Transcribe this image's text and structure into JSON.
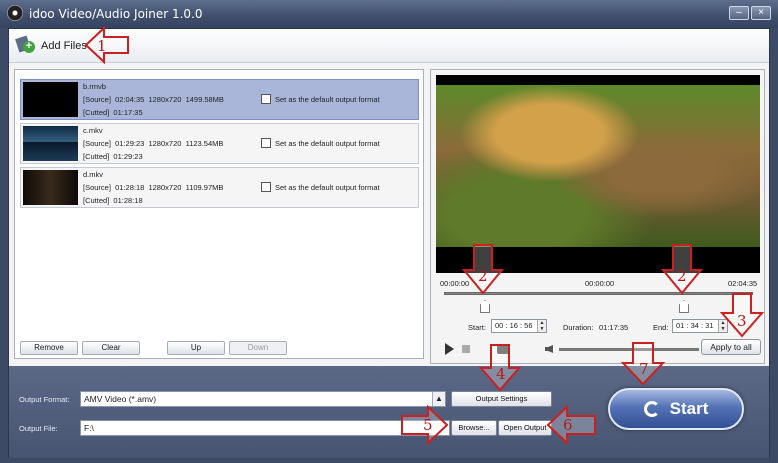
{
  "window": {
    "title": "idoo Video/Audio Joiner 1.0.0",
    "minimize": "–",
    "close": "×"
  },
  "toolbar": {
    "add_files_label": "Add Files"
  },
  "files": [
    {
      "name": "b.rmvb",
      "source": "[Source]  02:04:35  1280x720  1499.58MB",
      "cutted": "[Cutted]  01:17:35",
      "default_label": "Set as the default output format"
    },
    {
      "name": "c.mkv",
      "source": "[Source]  01:29:23  1280x720  1123.54MB",
      "cutted": "[Cutted]  01:29:23",
      "default_label": "Set as the default output format"
    },
    {
      "name": "d.mkv",
      "source": "[Source]  01:28:18  1280x720  1109.97MB",
      "cutted": "[Cutted]  01:28:18",
      "default_label": "Set as the default output format"
    }
  ],
  "list_buttons": {
    "remove": "Remove",
    "clear": "Clear",
    "up": "Up",
    "down": "Down"
  },
  "preview": {
    "time_start": "00:00:00",
    "time_mid": "00:00:00",
    "time_end": "02:04:35",
    "start_label": "Start:",
    "start_value": "00 : 16 : 56",
    "duration_label": "Duration:",
    "duration_value": "01:17:35",
    "end_label": "End:",
    "end_value": "01 : 34 : 31",
    "apply_label": "Apply to all"
  },
  "output": {
    "format_label": "Output Format:",
    "format_value": "AMV Video (*.amv)",
    "settings_button": "Output Settings",
    "file_label": "Output File:",
    "file_value": "F:\\",
    "browse_button": "Browse...",
    "open_button": "Open Output",
    "start_button": "Start"
  },
  "annotations": [
    "1",
    "2",
    "2",
    "3",
    "4",
    "5",
    "6",
    "7"
  ],
  "colors": {
    "accent": "#5472b6",
    "selected_row": "#a9b6da",
    "annotation_red": "#cc1f1f"
  }
}
